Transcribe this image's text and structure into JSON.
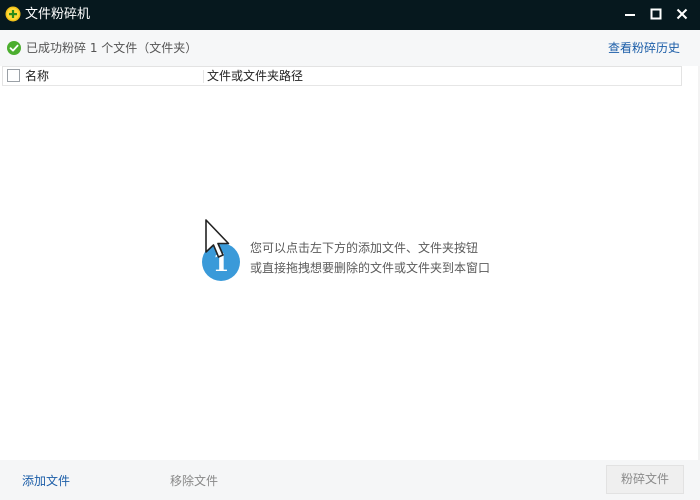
{
  "window": {
    "title": "文件粉碎机",
    "icon": "shredder-app-icon",
    "controls": [
      "minimize-icon",
      "maximize-icon",
      "close-icon"
    ]
  },
  "status": {
    "icon": "success-check-icon",
    "text": "已成功粉碎 1 个文件（文件夹）",
    "history_link": "查看粉碎历史"
  },
  "table": {
    "columns": [
      "名称",
      "文件或文件夹路径"
    ],
    "rows": []
  },
  "empty_state": {
    "badge_text": "1",
    "line1": "您可以点击左下方的添加文件、文件夹按钮",
    "line2": "或直接拖拽想要删除的文件或文件夹到本窗口"
  },
  "footer": {
    "add_label": "添加文件",
    "remove_label": "移除文件",
    "shred_label": "粉碎文件"
  },
  "colors": {
    "titlebar": "#06181e",
    "link": "#1c5ea8",
    "badge": "#3a9ad9",
    "success": "#4cae2f"
  }
}
